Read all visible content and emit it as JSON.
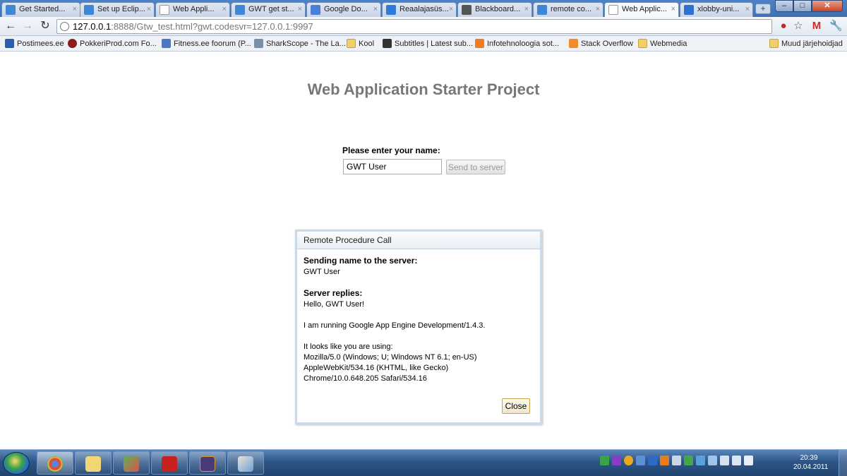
{
  "browser": {
    "tabs": [
      {
        "label": "Get Started...",
        "icon": "gwt-icon",
        "active": false
      },
      {
        "label": "Set up Eclip...",
        "icon": "gwt-icon",
        "active": false
      },
      {
        "label": "Web Appli...",
        "icon": "page-icon",
        "active": false
      },
      {
        "label": "GWT get st...",
        "icon": "gwt-icon",
        "active": false
      },
      {
        "label": "Google Do...",
        "icon": "google-docs-icon",
        "active": false
      },
      {
        "label": "Reaalajasüs...",
        "icon": "folder-icon",
        "active": false
      },
      {
        "label": "Blackboard...",
        "icon": "blackboard-icon",
        "active": false
      },
      {
        "label": "remote co...",
        "icon": "gwt-icon",
        "active": false
      },
      {
        "label": "Web Applic...",
        "icon": "page-icon",
        "active": true
      },
      {
        "label": "xlobby-uni...",
        "icon": "xlobby-icon",
        "active": false
      }
    ],
    "address": {
      "host": "127.0.0.1",
      "rest": ":8888/Gtw_test.html?gwt.codesvr=127.0.0.1:9997"
    },
    "bookmarks": [
      {
        "label": "Postimees.ee",
        "icon": "postimees-icon"
      },
      {
        "label": "PokkeriProd.com Fo...",
        "icon": "pokker-icon"
      },
      {
        "label": "Fitness.ee foorum (P...",
        "icon": "fitness-icon"
      },
      {
        "label": "SharkScope - The La...",
        "icon": "sharkscope-icon"
      },
      {
        "label": "Kool",
        "icon": "folder-icon"
      },
      {
        "label": "Subtitles | Latest sub...",
        "icon": "subtitles-icon"
      },
      {
        "label": "Infotehnoloogia sot...",
        "icon": "blogger-icon"
      },
      {
        "label": "Stack Overflow",
        "icon": "stackoverflow-icon"
      },
      {
        "label": "Webmedia",
        "icon": "folder-icon"
      }
    ],
    "other_bookmarks": "Muud järjehoidjad"
  },
  "page": {
    "title": "Web Application Starter Project",
    "name_label": "Please enter your name:",
    "name_value": "GWT User",
    "send_label": "Send to server"
  },
  "dialog": {
    "title": "Remote Procedure Call",
    "sending_heading": "Sending name to the server:",
    "sending_value": "GWT User",
    "reply_heading": "Server replies:",
    "reply_value": "Hello, GWT User!",
    "running_line": "I am running Google App Engine Development/1.4.3.",
    "using_line": "It looks like you are using:",
    "ua_lines": [
      "Mozilla/5.0 (Windows; U; Windows NT 6.1; en-US)",
      "AppleWebKit/534.16 (KHTML, like Gecko)",
      "Chrome/10.0.648.205 Safari/534.16"
    ],
    "close_label": "Close"
  },
  "taskbar": {
    "time": "20:39",
    "date": "20.04.2011"
  },
  "colors": {
    "title_gray": "#777777",
    "dialog_border": "#c9daea",
    "taskbar_blue": "#2d5586"
  }
}
